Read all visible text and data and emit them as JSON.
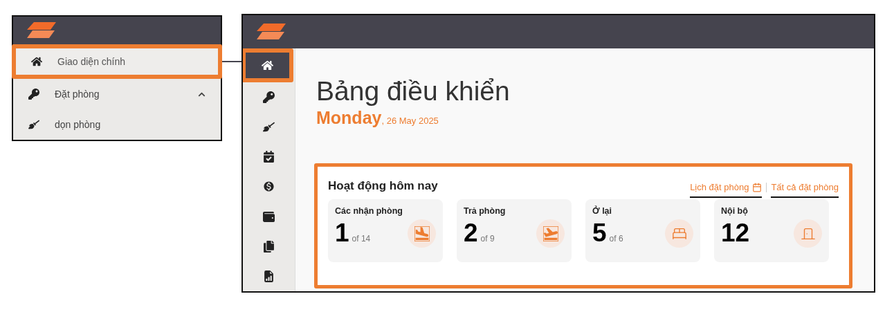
{
  "menu_preview": {
    "items": [
      {
        "label": "Giao diện chính",
        "selected": true,
        "highlighted": true
      },
      {
        "label": "Đặt phòng",
        "selected": false,
        "highlighted": false,
        "expanded": true
      },
      {
        "label": "dọn phòng",
        "selected": false,
        "highlighted": false
      }
    ]
  },
  "sidebar": {
    "items": [
      {
        "selected": true,
        "highlighted": true
      },
      {
        "selected": false,
        "highlighted": false
      },
      {
        "selected": false,
        "highlighted": false
      },
      {
        "selected": false,
        "highlighted": false
      },
      {
        "selected": false,
        "highlighted": false
      },
      {
        "selected": false,
        "highlighted": false
      },
      {
        "selected": false,
        "highlighted": false
      },
      {
        "selected": false,
        "highlighted": false
      }
    ]
  },
  "page": {
    "title": "Bảng điều khiển",
    "weekday": "Monday",
    "date": ", 26 May 2025"
  },
  "activity": {
    "title": "Hoạt động hôm nay",
    "highlighted": true,
    "links": [
      {
        "label": "Lịch đặt phòng",
        "kind": "calendar"
      },
      {
        "label": "Tất cả đặt phòng",
        "kind": "plain"
      }
    ],
    "stats": [
      {
        "label": "Các nhận phòng",
        "value": "1",
        "total": "of 14",
        "kind": "arrival"
      },
      {
        "label": "Trả phòng",
        "value": "2",
        "total": "of 9",
        "kind": "departure"
      },
      {
        "label": "Ở lại",
        "value": "5",
        "total": "of 6",
        "kind": "stay"
      },
      {
        "label": "Nội bộ",
        "value": "12",
        "kind": "inhouse"
      }
    ]
  }
}
